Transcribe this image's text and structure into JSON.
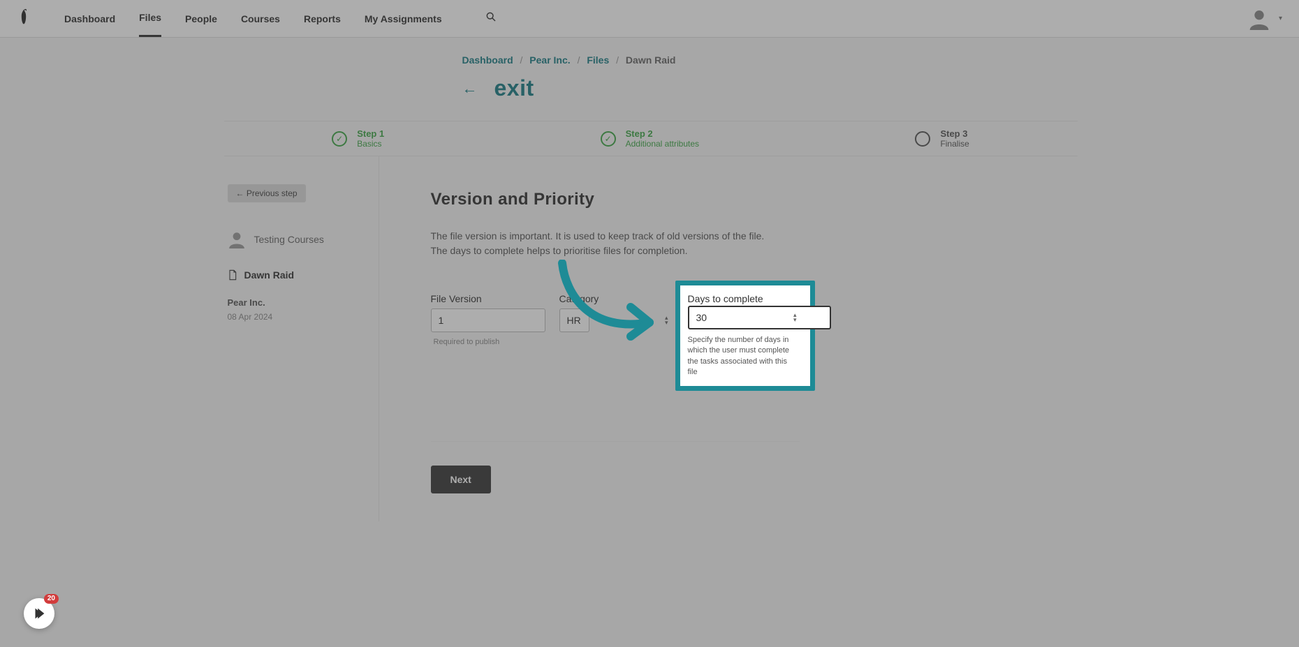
{
  "nav": {
    "items": [
      "Dashboard",
      "Files",
      "People",
      "Courses",
      "Reports",
      "My Assignments"
    ],
    "active_index": 1
  },
  "breadcrumb": {
    "links": [
      "Dashboard",
      "Pear Inc.",
      "Files"
    ],
    "current": "Dawn Raid"
  },
  "exit_label": "exit",
  "stepper": [
    {
      "title": "Step 1",
      "subtitle": "Basics",
      "status": "done"
    },
    {
      "title": "Step 2",
      "subtitle": "Additional attributes",
      "status": "done"
    },
    {
      "title": "Step 3",
      "subtitle": "Finalise",
      "status": "pending"
    }
  ],
  "sidebar": {
    "prev_button": "← Previous step",
    "user_name": "Testing Courses",
    "file_name": "Dawn Raid",
    "org": "Pear Inc.",
    "date": "08 Apr 2024"
  },
  "main": {
    "title": "Version and Priority",
    "description": "The file version is important. It is used to keep track of old versions of the file. The days to complete helps to prioritise files for completion.",
    "file_version": {
      "label": "File Version",
      "value": "1",
      "hint": "Required to publish"
    },
    "category": {
      "label": "Category",
      "value": "HR"
    },
    "days": {
      "label": "Days to complete",
      "value": "30",
      "help": "Specify the number of days in which the user must complete the tasks associated with this file"
    },
    "next_button": "Next"
  },
  "chat_badge": "20"
}
